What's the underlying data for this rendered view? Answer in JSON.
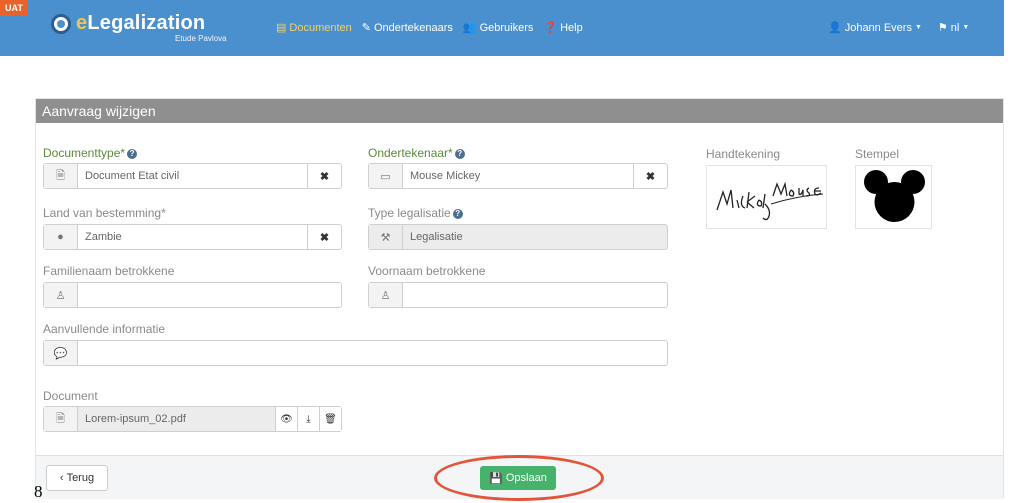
{
  "env_badge": "UAT",
  "brand": {
    "first_letter": "e",
    "rest": "Legalization",
    "subtitle": "Etude Pavlova",
    "logo_icon": "globe-pin-icon"
  },
  "nav": {
    "links": [
      {
        "icon": "document-icon",
        "label": "Documenten"
      },
      {
        "icon": "pencil-icon",
        "label": "Ondertekenaars"
      },
      {
        "icon": "users-icon",
        "label": "Gebruikers"
      },
      {
        "icon": "question-icon",
        "label": "Help"
      }
    ],
    "user": {
      "icon": "user-icon",
      "label": "Johann Evers"
    },
    "language": {
      "icon": "flag-icon",
      "label": "nl"
    }
  },
  "panel": {
    "title": "Aanvraag wijzigen"
  },
  "form": {
    "document_type": {
      "label": "Documenttype*",
      "value": "Document Etat civil"
    },
    "signer": {
      "label": "Ondertekenaar*",
      "value": "Mouse Mickey"
    },
    "destination_country": {
      "label": "Land van bestemming*",
      "value": "Zambie"
    },
    "legalisation_type": {
      "label": "Type legalisatie",
      "value": "Legalisatie"
    },
    "family_name": {
      "label": "Familienaam betrokkene",
      "value": ""
    },
    "first_name": {
      "label": "Voornaam betrokkene",
      "value": ""
    },
    "extra_info": {
      "label": "Aanvullende informatie",
      "value": ""
    },
    "document": {
      "label": "Document",
      "value": "Lorem-ipsum_02.pdf"
    }
  },
  "signature": {
    "label": "Handtekening",
    "text": "Mickey Mouse"
  },
  "stamp": {
    "label": "Stempel"
  },
  "buttons": {
    "back": "Terug",
    "save": "Opslaan"
  },
  "page_number": "8",
  "colors": {
    "navbar": "#4a8fce",
    "uat_badge": "#e8622a",
    "save_button": "#47b26b",
    "highlight_ellipse": "#e3553a"
  }
}
